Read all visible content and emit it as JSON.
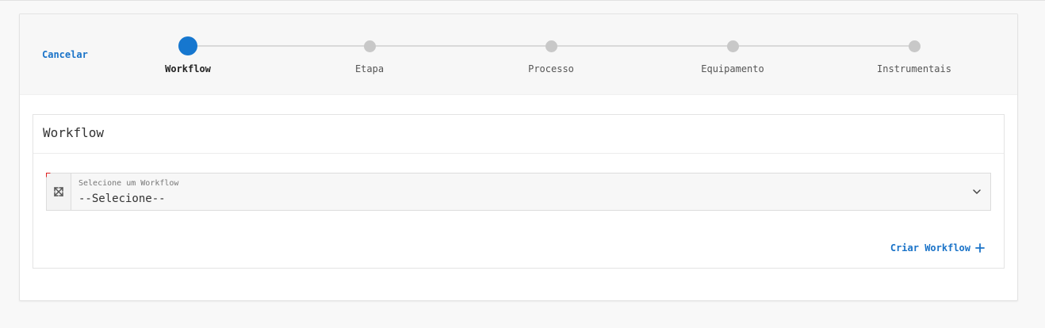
{
  "stepper": {
    "cancel_label": "Cancelar",
    "steps": [
      {
        "label": "Workflow",
        "active": true
      },
      {
        "label": "Etapa",
        "active": false
      },
      {
        "label": "Processo",
        "active": false
      },
      {
        "label": "Equipamento",
        "active": false
      },
      {
        "label": "Instrumentais",
        "active": false
      }
    ]
  },
  "workflow_card": {
    "title": "Workflow",
    "select": {
      "label": "Selecione um Workflow",
      "value": "--Selecione--",
      "required": true
    },
    "create_label": "Criar Workflow"
  },
  "colors": {
    "accent": "#1677cf",
    "link": "#1a73c8",
    "required": "#e02020"
  },
  "icons": {
    "expand": "expand-arrows-icon",
    "dropdown": "chevron-down-icon",
    "create": "plus-icon"
  }
}
